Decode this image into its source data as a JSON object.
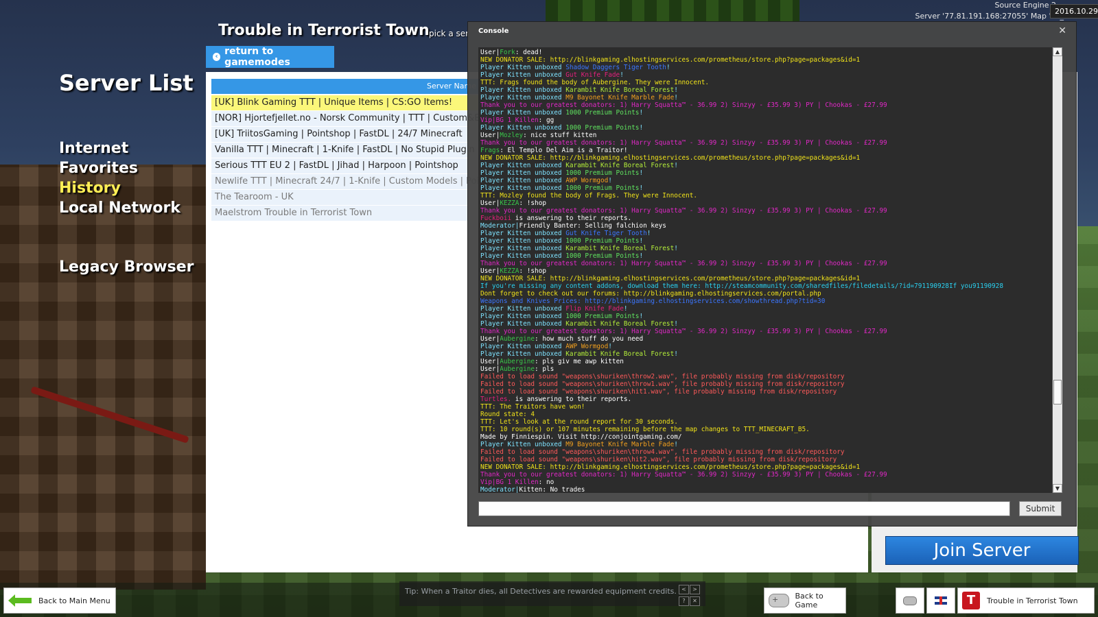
{
  "colors": {
    "accent": "#3597e6",
    "highlight_row": "#fbf77a",
    "active_nav": "#ffee55",
    "join": "#1b62b8"
  },
  "top_info": {
    "engine": "Source Engine 2…",
    "server": "Server '77.81.191.168:27055' Map 'ttt_",
    "date": "2016.10.29"
  },
  "page": {
    "title": "Server List"
  },
  "nav": {
    "items": [
      "Internet",
      "Favorites",
      "History",
      "Local Network"
    ],
    "active": "History",
    "legacy": "Legacy Browser"
  },
  "gamemode": {
    "title": "Trouble in Terrorist Town",
    "subtitle": "pick a ser",
    "return_label": "return to gamemodes"
  },
  "list": {
    "header": "Server Name",
    "rows": [
      "[UK] Blink Gaming TTT | Unique Items | CS:GO Items!",
      "[NOR] Hjortefjellet.no - Norsk Community | TTT | Custom&E",
      "[UK] TriitosGaming | Pointshop | FastDL | 24/7 Minecraft",
      "Vanilla TTT | Minecraft | 1-Knife | FastDL | No Stupid Plugin",
      "Serious TTT EU 2 | FastDL | Jihad | Harpoon | Pointshop",
      "Newlife TTT | Minecraft 24/7 | 1-Knife | Custom Models | Poi",
      "The Tearoom - UK",
      "Maelstrom Trouble in Terrorist Town"
    ]
  },
  "join_label": "Join Server",
  "console": {
    "title": "Console",
    "close": "✕",
    "submit": "Submit",
    "lines": [
      [
        [
          "User|",
          "#ffffff"
        ],
        [
          "Fork",
          "#39c74a"
        ],
        [
          ": dead!",
          "#ffffff"
        ]
      ],
      [
        [
          "NEW DONATOR SALE: http://blinkgaming.elhostingservices.com/prometheus/store.php?page=packages&id=1",
          "#f1e31a"
        ]
      ],
      [
        [
          "Player Kitten unboxed ",
          "#7fe3ff"
        ],
        [
          "Shadow Daggers Tiger Tooth",
          "#3b76ff"
        ],
        [
          "!",
          "#7fe3ff"
        ]
      ],
      [
        [
          "Player Kitten unboxed ",
          "#7fe3ff"
        ],
        [
          "Gut Knife Fade",
          "#e4207c"
        ],
        [
          "!",
          "#7fe3ff"
        ]
      ],
      [
        [
          "TTT:   Frags found the body of Aubergine. They were Innocent.",
          "#f1e31a"
        ]
      ],
      [
        [
          "Player Kitten unboxed ",
          "#7fe3ff"
        ],
        [
          "Karambit Knife Boreal Forest",
          "#b5f03a"
        ],
        [
          "!",
          "#7fe3ff"
        ]
      ],
      [
        [
          "Player Kitten unboxed ",
          "#7fe3ff"
        ],
        [
          "M9 Bayonet Knife Marble Fade",
          "#f2a01e"
        ],
        [
          "!",
          "#7fe3ff"
        ]
      ],
      [
        [
          "Thank you to our greatest donators: 1) Harry Squatta™ - 36.99 2) Sinzyy - £35.99 3) PY | Chookas - £27.99",
          "#e228c7"
        ]
      ],
      [
        [
          "Player Kitten unboxed ",
          "#7fe3ff"
        ],
        [
          "1000 Premium Points",
          "#5fe35f"
        ],
        [
          "!",
          "#7fe3ff"
        ]
      ],
      [
        [
          "Vip|BG 1 Killen",
          "#e228c7"
        ],
        [
          ": gg",
          "#ffffff"
        ]
      ],
      [
        [
          "Player Kitten unboxed ",
          "#7fe3ff"
        ],
        [
          "1000 Premium Points",
          "#5fe35f"
        ],
        [
          "!",
          "#7fe3ff"
        ]
      ],
      [
        [
          "User|",
          "#ffffff"
        ],
        [
          "Mozley",
          "#39c74a"
        ],
        [
          ": nice stuff kitten",
          "#ffffff"
        ]
      ],
      [
        [
          "Thank you to our greatest donators: 1) Harry Squatta™ - 36.99 2) Sinzyy - £35.99 3) PY | Chookas - £27.99",
          "#e228c7"
        ]
      ],
      [
        [
          "Frags",
          "#39c74a"
        ],
        [
          ": El Templo Del Aim is a Traitor!",
          "#ffffff"
        ]
      ],
      [
        [
          "NEW DONATOR SALE: http://blinkgaming.elhostingservices.com/prometheus/store.php?page=packages&id=1",
          "#f1e31a"
        ]
      ],
      [
        [
          "Player Kitten unboxed ",
          "#7fe3ff"
        ],
        [
          "Karambit Knife Boreal Forest",
          "#b5f03a"
        ],
        [
          "!",
          "#7fe3ff"
        ]
      ],
      [
        [
          "Player Kitten unboxed ",
          "#7fe3ff"
        ],
        [
          "1000 Premium Points",
          "#5fe35f"
        ],
        [
          "!",
          "#7fe3ff"
        ]
      ],
      [
        [
          "Player Kitten unboxed ",
          "#7fe3ff"
        ],
        [
          "AWP Wormgod",
          "#f2a01e"
        ],
        [
          "!",
          "#7fe3ff"
        ]
      ],
      [
        [
          "Player Kitten unboxed ",
          "#7fe3ff"
        ],
        [
          "1000 Premium Points",
          "#5fe35f"
        ],
        [
          "!",
          "#7fe3ff"
        ]
      ],
      [
        [
          "TTT:   Mozley found the body of Frags. They were Innocent.",
          "#f1e31a"
        ]
      ],
      [
        [
          "User|",
          "#ffffff"
        ],
        [
          "KEZZA",
          "#39c74a"
        ],
        [
          ": !shop",
          "#ffffff"
        ]
      ],
      [
        [
          "Thank you to our greatest donators: 1) Harry Squatta™ - 36.99 2) Sinzyy - £35.99 3) PY | Chookas - £27.99",
          "#e228c7"
        ]
      ],
      [
        [
          "Fuckboii",
          "#e4207c"
        ],
        [
          " is answering to their reports.",
          "#ffffff"
        ]
      ],
      [
        [
          "Moderator|",
          "#7fe3ff"
        ],
        [
          "Friendly Banter: Selling falchion keys",
          "#ffffff"
        ]
      ],
      [
        [
          "Player Kitten unboxed ",
          "#7fe3ff"
        ],
        [
          "Gut Knife Tiger Tooth",
          "#3b76ff"
        ],
        [
          "!",
          "#7fe3ff"
        ]
      ],
      [
        [
          "Player Kitten unboxed ",
          "#7fe3ff"
        ],
        [
          "1000 Premium Points",
          "#5fe35f"
        ],
        [
          "!",
          "#7fe3ff"
        ]
      ],
      [
        [
          "Player Kitten unboxed ",
          "#7fe3ff"
        ],
        [
          "Karambit Knife Boreal Forest",
          "#b5f03a"
        ],
        [
          "!",
          "#7fe3ff"
        ]
      ],
      [
        [
          "Player Kitten unboxed ",
          "#7fe3ff"
        ],
        [
          "1000 Premium Points",
          "#5fe35f"
        ],
        [
          "!",
          "#7fe3ff"
        ]
      ],
      [
        [
          "Thank you to our greatest donators: 1) Harry Squatta™ - 36.99 2) Sinzyy - £35.99 3) PY | Chookas - £27.99",
          "#e228c7"
        ]
      ],
      [
        [
          "User|",
          "#ffffff"
        ],
        [
          "KEZZA",
          "#39c74a"
        ],
        [
          ": !shop",
          "#ffffff"
        ]
      ],
      [
        [
          "NEW DONATOR SALE: http://blinkgaming.elhostingservices.com/prometheus/store.php?page=packages&id=1",
          "#f1e31a"
        ]
      ],
      [
        [
          "If you're missing any content addons, download them here: http://steamcommunity.com/sharedfiles/filedetails/?id=791190928If you91190928",
          "#2ad0f0"
        ]
      ],
      [
        [
          "Dont forget to check out our forums: http://blinkgaming.elhostingservices.com/portal.php",
          "#f1e31a"
        ]
      ],
      [
        [
          "Weapons and Knives Prices: http://blinkgaming.elhostingservices.com/showthread.php?tid=30",
          "#3b76ff"
        ]
      ],
      [
        [
          "Player Kitten unboxed ",
          "#7fe3ff"
        ],
        [
          "Flip Knife Fade",
          "#e4207c"
        ],
        [
          "!",
          "#7fe3ff"
        ]
      ],
      [
        [
          "Player Kitten unboxed ",
          "#7fe3ff"
        ],
        [
          "1000 Premium Points",
          "#5fe35f"
        ],
        [
          "!",
          "#7fe3ff"
        ]
      ],
      [
        [
          "Player Kitten unboxed ",
          "#7fe3ff"
        ],
        [
          "Karambit Knife Boreal Forest",
          "#b5f03a"
        ],
        [
          "!",
          "#7fe3ff"
        ]
      ],
      [
        [
          "Thank you to our greatest donators: 1) Harry Squatta™ - 36.99 2) Sinzyy - £35.99 3) PY | Chookas - £27.99",
          "#e228c7"
        ]
      ],
      [
        [
          "User|",
          "#ffffff"
        ],
        [
          "Aubergine",
          "#39c74a"
        ],
        [
          ": how much stuff do you need",
          "#ffffff"
        ]
      ],
      [
        [
          "Player Kitten unboxed ",
          "#7fe3ff"
        ],
        [
          "AWP Wormgod",
          "#f2a01e"
        ],
        [
          "!",
          "#7fe3ff"
        ]
      ],
      [
        [
          "Player Kitten unboxed ",
          "#7fe3ff"
        ],
        [
          "Karambit Knife Boreal Forest",
          "#b5f03a"
        ],
        [
          "!",
          "#7fe3ff"
        ]
      ],
      [
        [
          "User|",
          "#ffffff"
        ],
        [
          "Aubergine",
          "#39c74a"
        ],
        [
          ": pls giv me awp kitten",
          "#ffffff"
        ]
      ],
      [
        [
          "User|",
          "#ffffff"
        ],
        [
          "Aubergine",
          "#39c74a"
        ],
        [
          ": pls",
          "#ffffff"
        ]
      ],
      [
        [
          "Failed to load sound \"weapons\\shuriken\\throw2.wav\", file probably missing from disk/repository",
          "#ff5a5a"
        ]
      ],
      [
        [
          "Failed to load sound \"weapons\\shuriken\\throw1.wav\", file probably missing from disk/repository",
          "#ff5a5a"
        ]
      ],
      [
        [
          "Failed to load sound \"weapons\\shuriken\\hit1.wav\", file probably missing from disk/repository",
          "#ff5a5a"
        ]
      ],
      [
        [
          "Turtles.",
          "#e4207c"
        ],
        [
          " is answering to their reports.",
          "#ffffff"
        ]
      ],
      [
        [
          "TTT:   The Traitors have won!",
          "#f1e31a"
        ]
      ],
      [
        [
          "Round state: 4",
          "#f1e31a"
        ]
      ],
      [
        [
          "TTT:   Let's look at the round report for 30 seconds.",
          "#f1e31a"
        ]
      ],
      [
        [
          "TTT:   10 round(s) or 107 minutes remaining before the map changes to TTT_MINECRAFT_B5.",
          "#f1e31a"
        ]
      ],
      [
        [
          "Made by Finniespin. Visit http://conjointgaming.com/",
          "#ffffff"
        ]
      ],
      [
        [
          "Player Kitten unboxed ",
          "#7fe3ff"
        ],
        [
          "M9 Bayonet Knife Marble Fade",
          "#f2a01e"
        ],
        [
          "!",
          "#7fe3ff"
        ]
      ],
      [
        [
          "Failed to load sound \"weapons\\shuriken\\throw4.wav\", file probably missing from disk/repository",
          "#ff5a5a"
        ]
      ],
      [
        [
          "Failed to load sound \"weapons\\shuriken\\hit2.wav\", file probably missing from disk/repository",
          "#ff5a5a"
        ]
      ],
      [
        [
          "NEW DONATOR SALE: http://blinkgaming.elhostingservices.com/prometheus/store.php?page=packages&id=1",
          "#f1e31a"
        ]
      ],
      [
        [
          "Thank you to our greatest donators: 1) Harry Squatta™ - 36.99 2) Sinzyy - £35.99 3) PY | Chookas - £27.99",
          "#e228c7"
        ]
      ],
      [
        [
          "Vip|BG 1 Killen",
          "#e228c7"
        ],
        [
          ": no",
          "#ffffff"
        ]
      ],
      [
        [
          "Moderator|",
          "#7fe3ff"
        ],
        [
          "Kitten: No trades",
          "#ffffff"
        ]
      ]
    ]
  },
  "bottom": {
    "back_main": "Back to Main Menu",
    "tip": "Tip: When a Traitor dies, all Detectives are rewarded equipment credits.",
    "back_game": "Back to Game",
    "gamemode_label": "Trouble in Terrorist Town",
    "gamemode_icon_letter": "T"
  }
}
